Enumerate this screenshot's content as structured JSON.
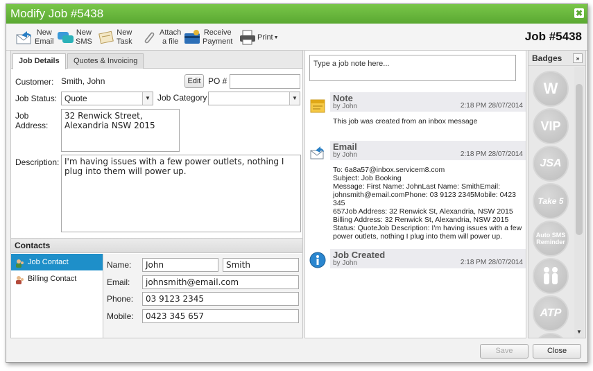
{
  "window": {
    "title": "Modify Job #5438",
    "close_glyph": "✖"
  },
  "toolbar": {
    "items": [
      {
        "line1": "New",
        "line2": "Email",
        "icon": "email-icon"
      },
      {
        "line1": "New",
        "line2": "SMS",
        "icon": "sms-icon"
      },
      {
        "line1": "New",
        "line2": "Task",
        "icon": "task-icon"
      },
      {
        "line1": "Attach",
        "line2": "a file",
        "icon": "paperclip-icon"
      },
      {
        "line1": "Receive",
        "line2": "Payment",
        "icon": "payment-icon"
      }
    ],
    "print_label": "Print",
    "job_heading": "Job #5438"
  },
  "tabs": {
    "details": "Job Details",
    "quotes": "Quotes & Invoicing"
  },
  "details": {
    "customer_label": "Customer:",
    "customer_value": "Smith, John",
    "edit_label": "Edit",
    "po_label": "PO #",
    "po_value": "",
    "status_label": "Job Status:",
    "status_value": "Quote",
    "category_label": "Job Category",
    "category_value": "",
    "address_label_1": "Job",
    "address_label_2": "Address:",
    "address_line_1": "32 Renwick Street,",
    "address_line_2": "Alexandria NSW 2015",
    "description_label": "Description:",
    "description_value": "I'm having issues with a few power outlets, nothing I plug into them will power up."
  },
  "contacts": {
    "heading": "Contacts",
    "items": [
      {
        "label": "Job Contact"
      },
      {
        "label": "Billing Contact"
      }
    ],
    "name_label": "Name:",
    "first_name": "John",
    "last_name": "Smith",
    "email_label": "Email:",
    "email": "johnsmith@email.com",
    "phone_label": "Phone:",
    "phone": "03 9123 2345",
    "mobile_label": "Mobile:",
    "mobile": "0423 345 657"
  },
  "notes": {
    "placeholder": "Type a job note here...",
    "entries": [
      {
        "title": "Note",
        "by": "by John",
        "time": "2:18 PM 28/07/2014",
        "body": [
          "This job was created from an inbox message"
        ]
      },
      {
        "title": "Email",
        "by": "by John",
        "time": "2:18 PM 28/07/2014",
        "body": [
          "To: 6a8a57@inbox.servicem8.com",
          "Subject: Job Booking",
          "Message: First Name: JohnLast Name: SmithEmail:",
          "johnsmith@email.comPhone: 03 9123 2345Mobile: 0423 345",
          "657Job Address: 32 Renwick St, Alexandria, NSW 2015",
          "Billing Address: 32 Renwick St, Alexandria, NSW 2015",
          "Status: QuoteJob Description: I'm having issues with a few",
          "power outlets, nothing I plug into them will power up."
        ]
      },
      {
        "title": "Job Created",
        "by": "by John",
        "time": "2:18 PM 28/07/2014",
        "body": []
      }
    ]
  },
  "badges": {
    "heading": "Badges",
    "expand_glyph": "»",
    "items": [
      "W",
      "VIP",
      "JSA",
      "Take 5",
      "Auto SMS Reminder",
      "",
      "ATP",
      ""
    ]
  },
  "footer": {
    "save": "Save",
    "close": "Close"
  },
  "colors": {
    "title_green": "#5aa832",
    "selected_blue": "#1e8fc9"
  }
}
